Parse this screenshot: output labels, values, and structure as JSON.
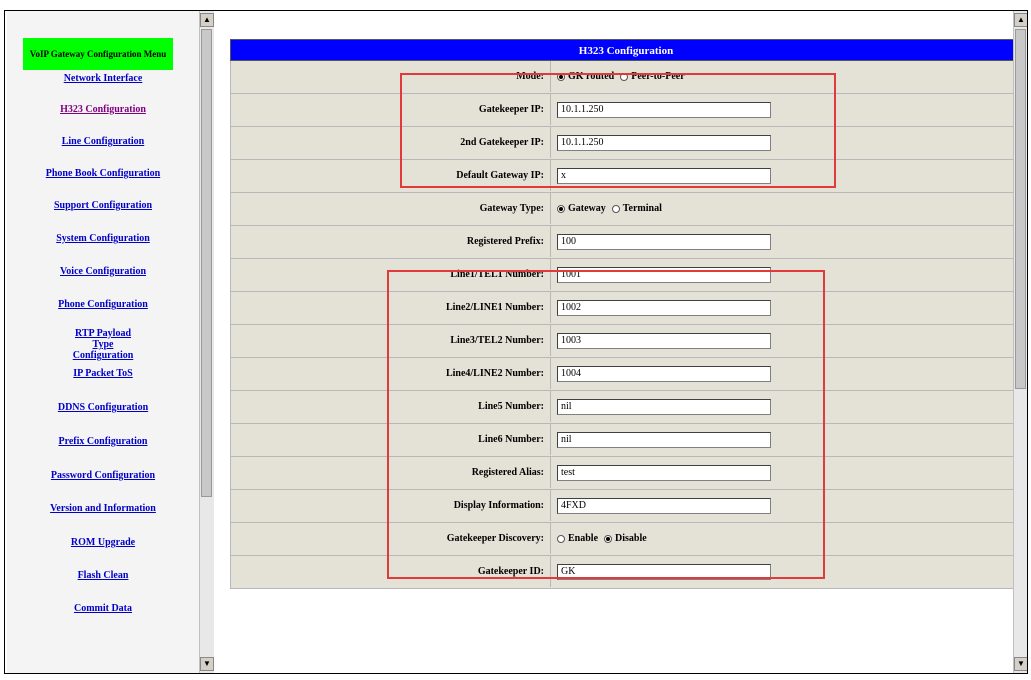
{
  "menu": {
    "header": "VoIP Gateway Configuration Menu",
    "items": [
      {
        "label": "Network Interface",
        "visited": false
      },
      {
        "label": "H323 Configuration",
        "visited": true
      },
      {
        "label": "Line Configuration",
        "visited": false
      },
      {
        "label": "Phone Book Configuration",
        "visited": false
      },
      {
        "label": "Support Configuration",
        "visited": false
      },
      {
        "label": "System Configuration",
        "visited": false
      },
      {
        "label": "Voice Configuration",
        "visited": false
      },
      {
        "label": "Phone Configuration",
        "visited": false
      },
      {
        "label": "RTP Payload Type Configuration",
        "visited": false
      },
      {
        "label": "IP Packet ToS",
        "visited": false
      },
      {
        "label": "DDNS Configuration",
        "visited": false
      },
      {
        "label": "Prefix Configuration",
        "visited": false
      },
      {
        "label": "Password Configuration",
        "visited": false
      },
      {
        "label": "Version and Information",
        "visited": false
      },
      {
        "label": "ROM Upgrade",
        "visited": false
      },
      {
        "label": "Flash Clean",
        "visited": false
      },
      {
        "label": "Commit Data",
        "visited": false
      }
    ]
  },
  "config": {
    "title": "H323 Configuration",
    "mode": {
      "label": "Mode:",
      "options": [
        "GK routed",
        "Peer-to-Peer"
      ],
      "selected": 0
    },
    "gatekeeper_ip": {
      "label": "Gatekeeper IP:",
      "value": "10.1.1.250"
    },
    "gatekeeper_ip2": {
      "label": "2nd Gatekeeper IP:",
      "value": "10.1.1.250"
    },
    "default_gateway_ip": {
      "label": "Default Gateway IP:",
      "value": "x"
    },
    "gateway_type": {
      "label": "Gateway Type:",
      "options": [
        "Gateway",
        "Terminal"
      ],
      "selected": 0
    },
    "registered_prefix": {
      "label": "Registered Prefix:",
      "value": "100"
    },
    "line1": {
      "label": "Line1/TEL1 Number:",
      "value": "1001"
    },
    "line2": {
      "label": "Line2/LINE1 Number:",
      "value": "1002"
    },
    "line3": {
      "label": "Line3/TEL2 Number:",
      "value": "1003"
    },
    "line4": {
      "label": "Line4/LINE2 Number:",
      "value": "1004"
    },
    "line5": {
      "label": "Line5 Number:",
      "value": "nil"
    },
    "line6": {
      "label": "Line6 Number:",
      "value": "nil"
    },
    "registered_alias": {
      "label": "Registered Alias:",
      "value": "test"
    },
    "display_information": {
      "label": "Display Information:",
      "value": "4FXD"
    },
    "gatekeeper_discovery": {
      "label": "Gatekeeper Discovery:",
      "options": [
        "Enable",
        "Disable"
      ],
      "selected": 1
    },
    "gatekeeper_id": {
      "label": "Gatekeeper ID:",
      "value": "GK"
    }
  },
  "colors": {
    "title_bar": "#0000ff",
    "menu_header": "#00ff00",
    "highlight": "#e03a3a",
    "link": "#0000c8",
    "visited_link": "#800080"
  }
}
